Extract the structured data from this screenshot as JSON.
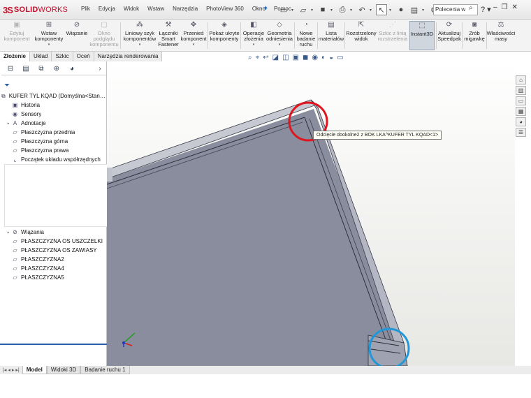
{
  "app": {
    "logo_prefix": "3S",
    "logo_solid": "SOLID",
    "logo_works": "WORKS"
  },
  "menu": [
    "Plik",
    "Edycja",
    "Widok",
    "Wstaw",
    "Narzędzia",
    "PhotoView 360",
    "Okno",
    "Pomoc"
  ],
  "search": {
    "value": "Polecenia w"
  },
  "quick_access": {
    "new_icon": "new-document-icon",
    "open_icon": "open-icon",
    "save_icon": "save-icon",
    "print_icon": "print-icon",
    "undo_icon": "undo-icon",
    "select_icon": "select-arrow-icon",
    "rebuild_icon": "rebuild-icon",
    "file_props_icon": "file-properties-icon",
    "options_icon": "options-gear-icon",
    "k_label": "K"
  },
  "ribbon": [
    {
      "label": "Edytuj komponent",
      "disabled": true
    },
    {
      "label": "Wstaw komponenty",
      "disabled": false
    },
    {
      "label": "Wiązanie",
      "disabled": false
    },
    {
      "label": "Okno podglądu komponentu",
      "disabled": true
    },
    {
      "label": "Liniowy szyk komponentów",
      "disabled": false
    },
    {
      "label": "Łączniki Smart Fastener",
      "disabled": false
    },
    {
      "label": "Przenieś komponent",
      "disabled": false
    },
    {
      "label": "Pokaż ukryte komponenty",
      "disabled": false
    },
    {
      "label": "Operacje złożenia",
      "disabled": false
    },
    {
      "label": "Geometria odniesienia",
      "disabled": false
    },
    {
      "label": "Nowe badanie ruchu",
      "disabled": false
    },
    {
      "label": "Lista materiałów",
      "disabled": false
    },
    {
      "label": "Rozstrzelony widok",
      "disabled": false
    },
    {
      "label": "Szkic z linią rozstrzelenia",
      "disabled": true
    },
    {
      "label": "Instant3D",
      "disabled": false,
      "active": true
    },
    {
      "label": "Aktualizuj Speedpak",
      "disabled": false
    },
    {
      "label": "Zrób migawkę",
      "disabled": false
    },
    {
      "label": "Właściwości masy",
      "disabled": false
    }
  ],
  "command_tabs": [
    {
      "label": "Złożenie",
      "selected": true
    },
    {
      "label": "Układ",
      "selected": false
    },
    {
      "label": "Szkic",
      "selected": false
    },
    {
      "label": "Oceń",
      "selected": false
    },
    {
      "label": "Narzędzia renderowania",
      "selected": false
    }
  ],
  "feature_tree": {
    "root": "KUFER TYL KQAD  (Domyślna<Stan wyświe",
    "items_top": [
      {
        "label": "Historia",
        "icon": "history-folder-icon",
        "expandable": false
      },
      {
        "label": "Sensory",
        "icon": "sensors-icon",
        "expandable": false
      },
      {
        "label": "Adnotacje",
        "icon": "annotations-icon",
        "expandable": true
      },
      {
        "label": "Płaszczyzna przednia",
        "icon": "plane-icon",
        "expandable": false
      },
      {
        "label": "Płaszczyzna górna",
        "icon": "plane-icon",
        "expandable": false
      },
      {
        "label": "Płaszczyzna prawa",
        "icon": "plane-icon",
        "expandable": false
      },
      {
        "label": "Początek układu współrzędnych",
        "icon": "origin-icon",
        "expandable": false
      }
    ],
    "items_bottom": [
      {
        "label": "Wiązania",
        "icon": "mates-icon",
        "expandable": true
      },
      {
        "label": "PŁASZCZYZNA OS USZCZELKI",
        "icon": "plane-icon",
        "expandable": false
      },
      {
        "label": "PŁASZCZYZNA OS ZAWIASY",
        "icon": "plane-icon",
        "expandable": false
      },
      {
        "label": "PŁASZCZYZNA2",
        "icon": "plane-icon",
        "expandable": false
      },
      {
        "label": "PŁASZCZYZNA4",
        "icon": "plane-icon",
        "expandable": false
      },
      {
        "label": "PŁASZCZYZNA5",
        "icon": "plane-icon",
        "expandable": false
      }
    ]
  },
  "viewport": {
    "tooltip": "Odcięcie dookolne2 z BOK LKA^KUFER TYL KQAD<1>",
    "highlight_red": "#e0161e",
    "highlight_blue": "#1f97d8",
    "part_color": "#8a8d9e"
  },
  "bottom_tabs": [
    {
      "label": "Model",
      "selected": true
    },
    {
      "label": "Widoki 3D",
      "selected": false
    },
    {
      "label": "Badanie ruchu 1",
      "selected": false
    }
  ]
}
